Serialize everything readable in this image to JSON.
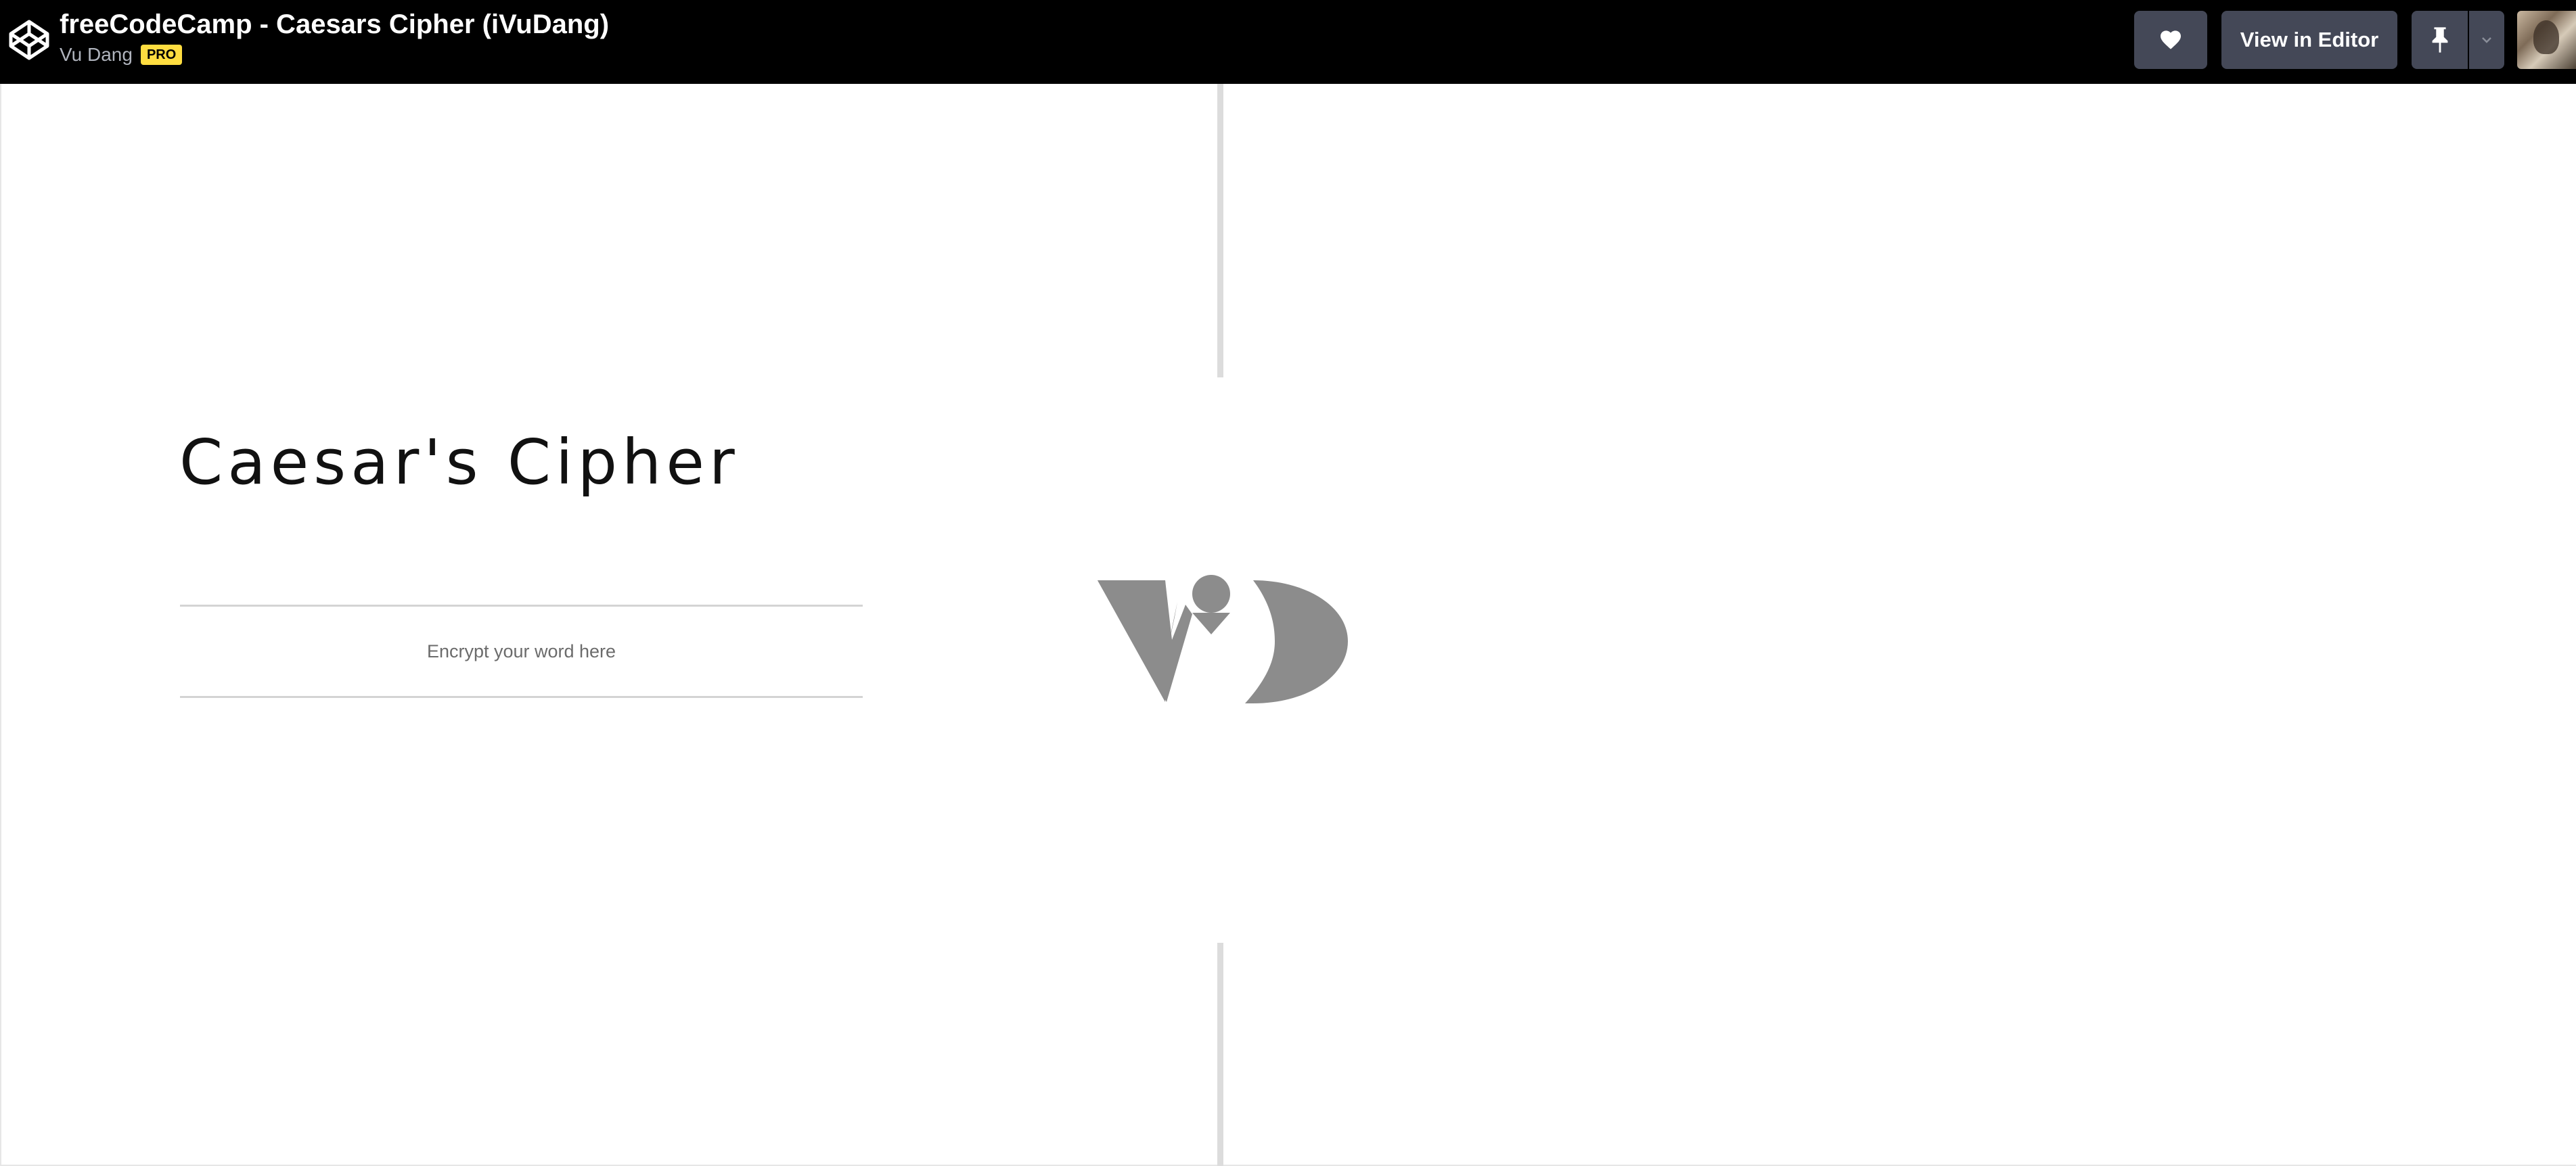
{
  "topbar": {
    "pen_title": "freeCodeCamp - Caesars Cipher (iVuDang)",
    "author": "Vu Dang",
    "badge": "PRO",
    "view_in_editor_label": "View in Editor"
  },
  "icons": {
    "logo": "codepen-logo-icon",
    "heart": "heart-icon",
    "pin": "pin-icon",
    "dropdown": "chevron-down-icon"
  },
  "preview": {
    "heading": "Caesar's Cipher",
    "input_placeholder": "Encrypt your word here",
    "input_value": ""
  },
  "colors": {
    "topbar_bg": "#000000",
    "button_bg": "#444857",
    "badge_bg": "#ffdd40",
    "logo_gray": "#8c8c8c"
  }
}
